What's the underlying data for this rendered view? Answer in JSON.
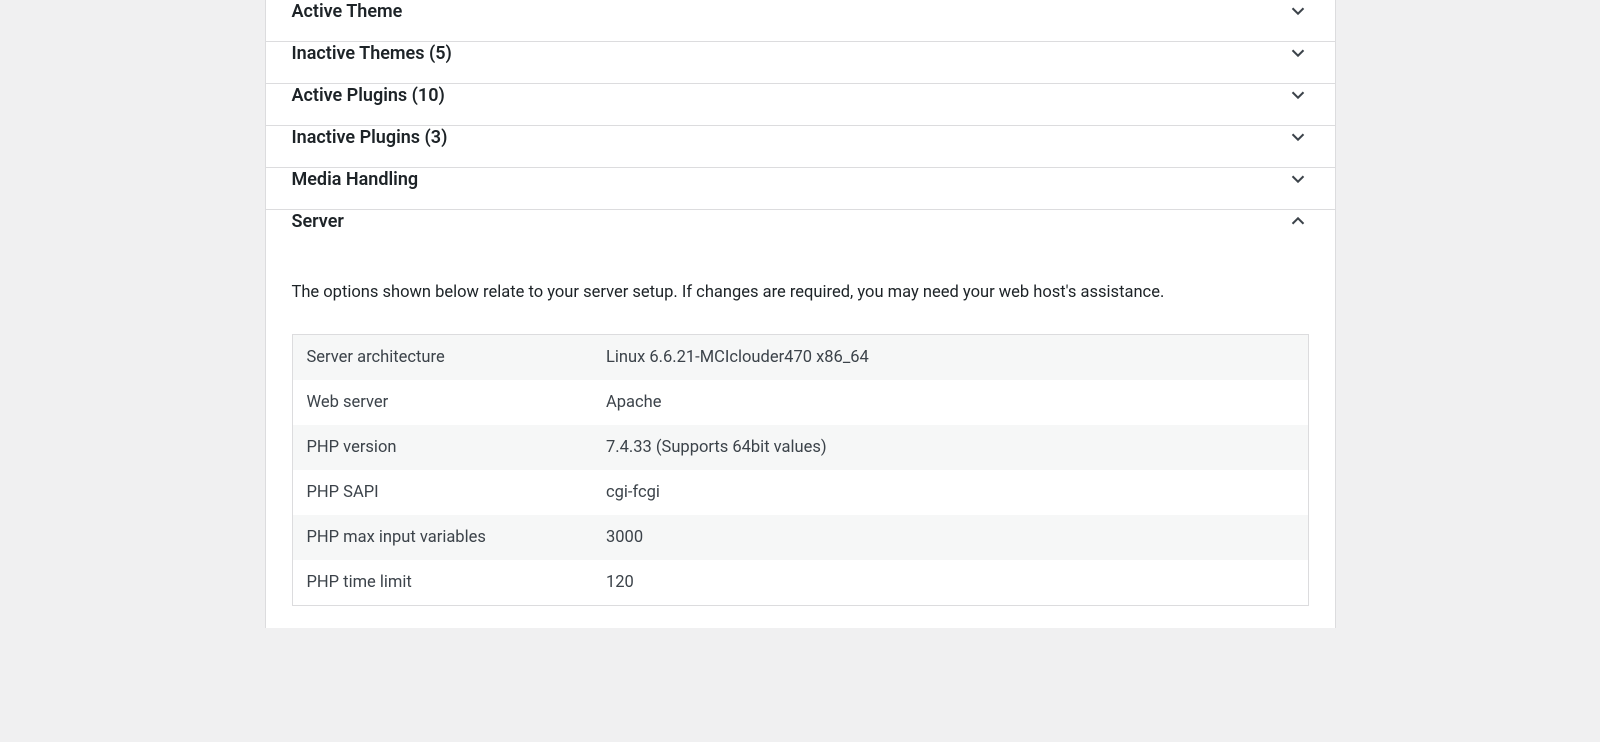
{
  "sections": [
    {
      "title": "Active Theme",
      "expanded": false
    },
    {
      "title": "Inactive Themes (5)",
      "expanded": false
    },
    {
      "title": "Active Plugins (10)",
      "expanded": false
    },
    {
      "title": "Inactive Plugins (3)",
      "expanded": false
    },
    {
      "title": "Media Handling",
      "expanded": false
    },
    {
      "title": "Server",
      "expanded": true
    }
  ],
  "server": {
    "description": "The options shown below relate to your server setup. If changes are required, you may need your web host's assistance.",
    "rows": [
      {
        "label": "Server architecture",
        "value": "Linux 6.6.21-MCIclouder470 x86_64"
      },
      {
        "label": "Web server",
        "value": "Apache"
      },
      {
        "label": "PHP version",
        "value": "7.4.33 (Supports 64bit values)"
      },
      {
        "label": "PHP SAPI",
        "value": "cgi-fcgi"
      },
      {
        "label": "PHP max input variables",
        "value": "3000"
      },
      {
        "label": "PHP time limit",
        "value": "120"
      }
    ]
  }
}
